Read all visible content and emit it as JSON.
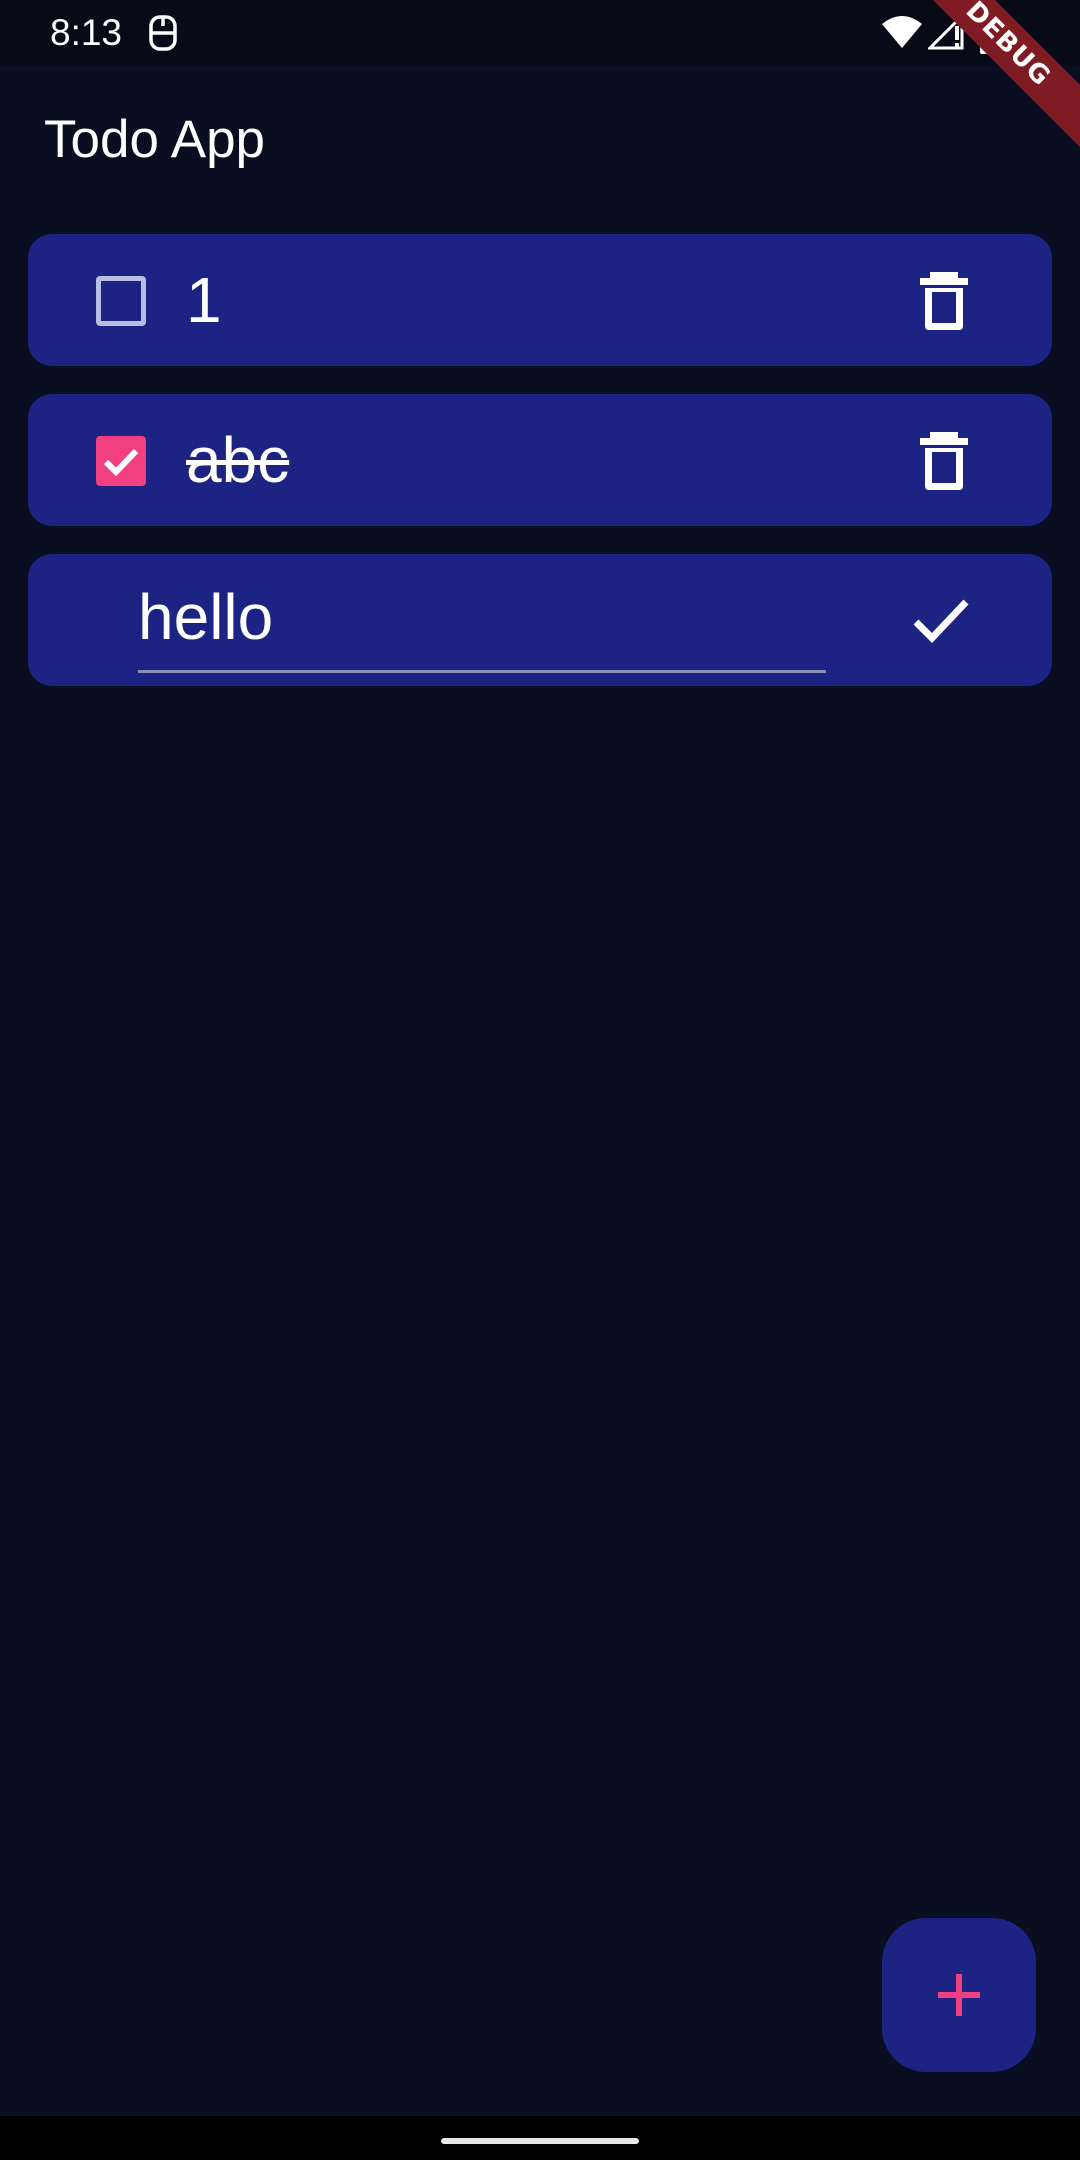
{
  "status_bar": {
    "time": "8:13",
    "icons": [
      "sim-card-icon",
      "wifi-icon",
      "signal-icon",
      "battery-icon"
    ]
  },
  "debug_banner": {
    "label": "DEBUG",
    "color": "#7f1b22"
  },
  "app_bar": {
    "title": "Todo App"
  },
  "todos": [
    {
      "text": "1",
      "completed": false
    },
    {
      "text": "abc",
      "completed": true
    }
  ],
  "editing": {
    "value": "hello",
    "confirm_icon": "check-icon"
  },
  "fab": {
    "icon": "add-icon"
  },
  "colors": {
    "background": "#0a0e21",
    "card": "#1c2383",
    "accent": "#f23f80",
    "text": "#ffffff"
  }
}
